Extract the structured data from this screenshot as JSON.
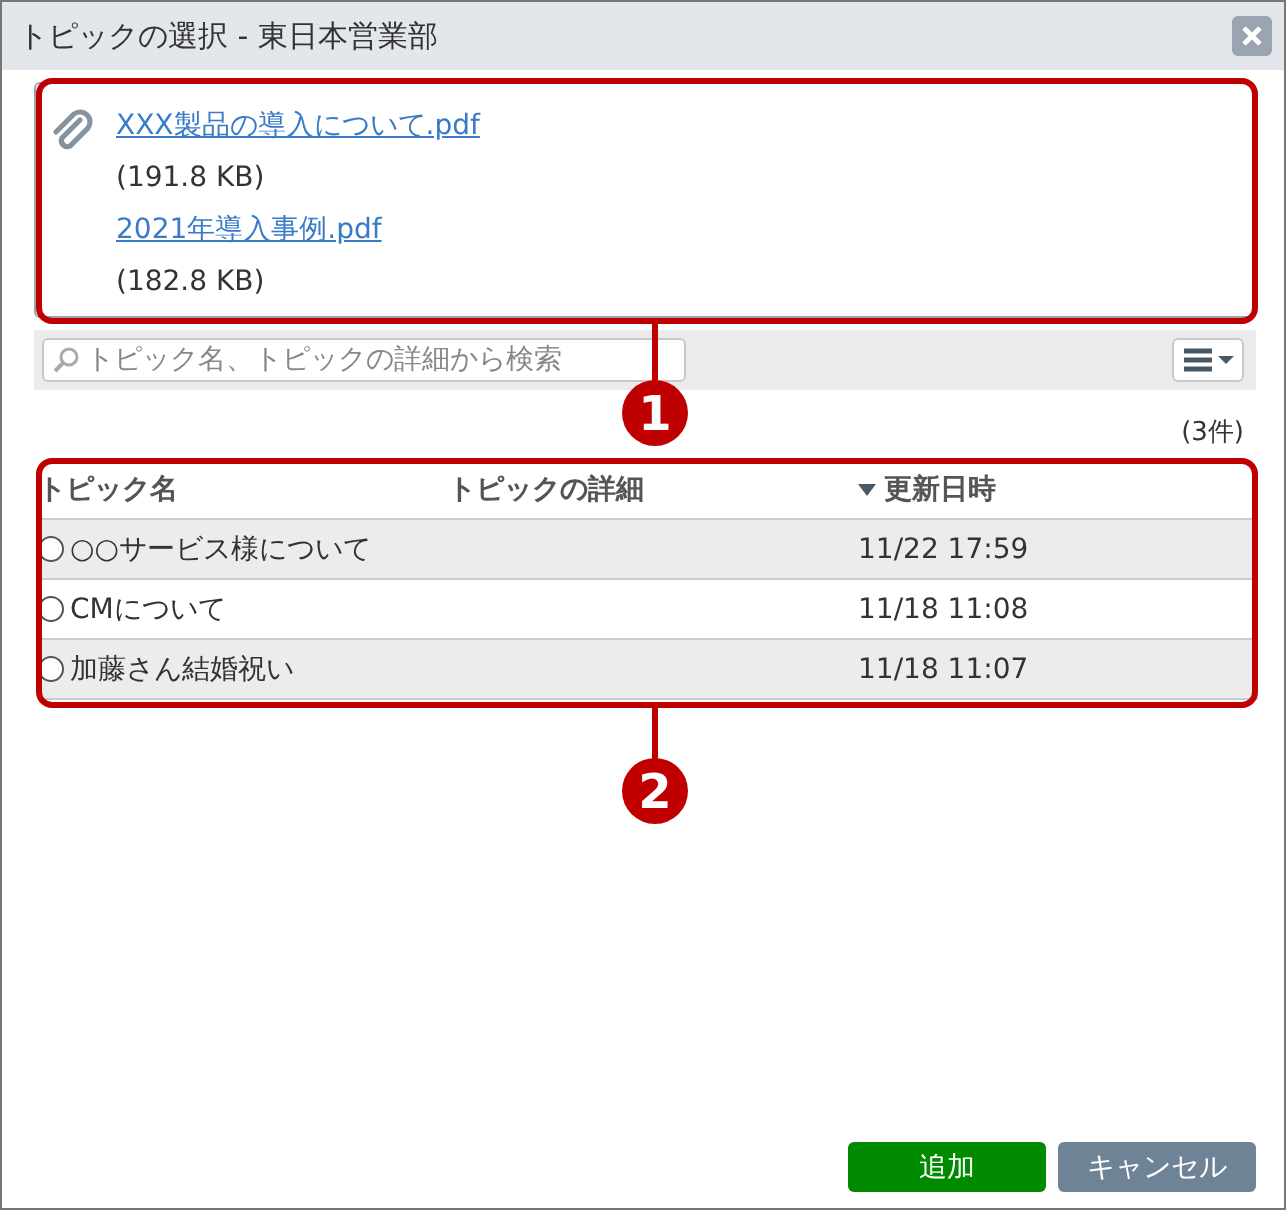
{
  "window": {
    "title": "トピックの選択 - 東日本営業部"
  },
  "attachments": [
    {
      "name": "XXX製品の導入について.pdf",
      "size": "(191.8 KB)"
    },
    {
      "name": "2021年導入事例.pdf",
      "size": "(182.8 KB)"
    }
  ],
  "search": {
    "placeholder": "トピック名、トピックの詳細から検索"
  },
  "count": "(3件)",
  "table": {
    "columns": [
      {
        "label": "トピック名",
        "sorted": false
      },
      {
        "label": "トピックの詳細",
        "sorted": false
      },
      {
        "label": "更新日時",
        "sorted": true
      }
    ],
    "rows": [
      {
        "name": "○○サービス様について",
        "updated": "11/22 17:59",
        "selected": false
      },
      {
        "name": "CMについて",
        "updated": "11/18 11:08",
        "selected": false
      },
      {
        "name": "加藤さん結婚祝い",
        "updated": "11/18 11:07",
        "selected": false
      }
    ]
  },
  "buttons": [
    {
      "label": "追加",
      "kind": "primary"
    },
    {
      "label": "キャンセル",
      "kind": "secondary"
    }
  ],
  "annotations": [
    {
      "label": "1"
    },
    {
      "label": "2"
    }
  ]
}
